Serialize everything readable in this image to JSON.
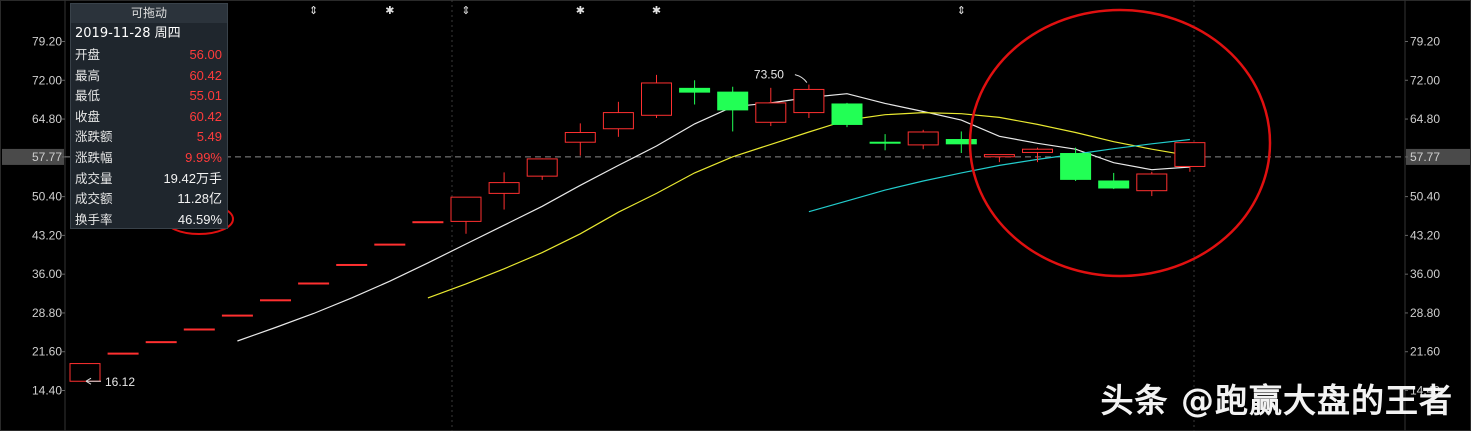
{
  "info_panel": {
    "title": "可拖动",
    "date": "2019-11-28 周四",
    "rows": [
      {
        "label": "开盘",
        "value": "56.00",
        "color": "#ff3b3b"
      },
      {
        "label": "最高",
        "value": "60.42",
        "color": "#ff3b3b"
      },
      {
        "label": "最低",
        "value": "55.01",
        "color": "#ff3b3b"
      },
      {
        "label": "收盘",
        "value": "60.42",
        "color": "#ff3b3b"
      },
      {
        "label": "涨跌额",
        "value": "5.49",
        "color": "#ff3b3b"
      },
      {
        "label": "涨跌幅",
        "value": "9.99%",
        "color": "#ff3b3b"
      },
      {
        "label": "成交量",
        "value": "19.42万手",
        "color": "#f2f2f2"
      },
      {
        "label": "成交额",
        "value": "11.28亿",
        "color": "#f2f2f2"
      },
      {
        "label": "换手率",
        "value": "46.59%",
        "color": "#f2f2f2"
      }
    ]
  },
  "watermark": "头条 @跑赢大盘的王者",
  "colors": {
    "up": "#ff3030",
    "down": "#22ff55",
    "ma_white": "#e8e8e8",
    "ma_yellow": "#e8e830",
    "ma_cyan": "#22cccc",
    "annotation_red": "#e01010"
  },
  "chart_data": {
    "type": "candlestick",
    "y_ticks": [
      "79.20",
      "72.00",
      "64.80",
      "57.77",
      "50.40",
      "43.20",
      "36.00",
      "28.80",
      "21.60",
      "14.40"
    ],
    "ylim": [
      9.0,
      84.0
    ],
    "last_price_label": "57.77",
    "annotations": {
      "high": "73.50",
      "low": "16.12"
    },
    "event_markers": [
      "⇕",
      "✱",
      "⇕",
      "✱",
      "✱",
      "⇕"
    ],
    "candles": [
      {
        "o": 16.12,
        "h": 19.4,
        "l": 16.12,
        "c": 19.4
      },
      {
        "o": 21.34,
        "h": 21.34,
        "l": 21.34,
        "c": 21.34
      },
      {
        "o": 23.47,
        "h": 23.47,
        "l": 23.47,
        "c": 23.47
      },
      {
        "o": 25.82,
        "h": 25.82,
        "l": 25.82,
        "c": 25.82
      },
      {
        "o": 28.4,
        "h": 28.4,
        "l": 28.4,
        "c": 28.4
      },
      {
        "o": 31.24,
        "h": 31.24,
        "l": 31.24,
        "c": 31.24
      },
      {
        "o": 34.36,
        "h": 34.36,
        "l": 34.36,
        "c": 34.36
      },
      {
        "o": 37.8,
        "h": 37.8,
        "l": 37.8,
        "c": 37.8
      },
      {
        "o": 41.58,
        "h": 41.58,
        "l": 41.58,
        "c": 41.58
      },
      {
        "o": 45.74,
        "h": 45.74,
        "l": 45.74,
        "c": 45.74
      },
      {
        "o": 45.8,
        "h": 50.3,
        "l": 43.5,
        "c": 50.3
      },
      {
        "o": 51.0,
        "h": 54.9,
        "l": 48.0,
        "c": 53.0
      },
      {
        "o": 54.2,
        "h": 57.5,
        "l": 53.5,
        "c": 57.4
      },
      {
        "o": 60.5,
        "h": 64.0,
        "l": 58.0,
        "c": 62.3
      },
      {
        "o": 63.0,
        "h": 68.0,
        "l": 61.5,
        "c": 66.0
      },
      {
        "o": 65.5,
        "h": 73.0,
        "l": 65.0,
        "c": 71.5
      },
      {
        "o": 70.5,
        "h": 72.0,
        "l": 67.5,
        "c": 69.8
      },
      {
        "o": 69.8,
        "h": 70.8,
        "l": 62.5,
        "c": 66.5
      },
      {
        "o": 64.2,
        "h": 70.6,
        "l": 63.5,
        "c": 67.8
      },
      {
        "o": 66.0,
        "h": 71.2,
        "l": 65.0,
        "c": 70.3
      },
      {
        "o": 67.6,
        "h": 67.8,
        "l": 63.3,
        "c": 63.8
      },
      {
        "o": 60.5,
        "h": 62.0,
        "l": 59.0,
        "c": 60.4
      },
      {
        "o": 60.0,
        "h": 62.8,
        "l": 59.2,
        "c": 62.4
      },
      {
        "o": 61.0,
        "h": 62.5,
        "l": 58.5,
        "c": 60.2
      },
      {
        "o": 57.8,
        "h": 58.2,
        "l": 56.8,
        "c": 58.2
      },
      {
        "o": 58.6,
        "h": 59.5,
        "l": 56.8,
        "c": 59.2
      },
      {
        "o": 58.4,
        "h": 59.5,
        "l": 53.3,
        "c": 53.6
      },
      {
        "o": 53.3,
        "h": 54.8,
        "l": 51.8,
        "c": 52.0
      },
      {
        "o": 51.5,
        "h": 55.0,
        "l": 50.5,
        "c": 54.6
      },
      {
        "o": 56.0,
        "h": 60.42,
        "l": 55.01,
        "c": 60.42
      }
    ],
    "ma_white": [
      null,
      null,
      null,
      null,
      23.6,
      26.1,
      28.7,
      31.6,
      34.7,
      38.1,
      41.6,
      45.1,
      48.6,
      52.5,
      56.2,
      59.8,
      63.9,
      67.1,
      67.8,
      68.8,
      69.5,
      67.7,
      66.2,
      64.6,
      61.6,
      60.3,
      59.2,
      56.7,
      55.4,
      55.9
    ],
    "ma_yellow": [
      null,
      null,
      null,
      null,
      null,
      null,
      null,
      null,
      null,
      31.6,
      34.2,
      37.0,
      40.0,
      43.5,
      47.5,
      51.0,
      54.8,
      57.8,
      60.1,
      62.4,
      64.6,
      65.6,
      66.0,
      65.8,
      65.1,
      63.8,
      62.3,
      60.6,
      59.2,
      58.0
    ],
    "ma_cyan": [
      null,
      null,
      null,
      null,
      null,
      null,
      null,
      null,
      null,
      null,
      null,
      null,
      null,
      null,
      null,
      null,
      null,
      null,
      null,
      47.6,
      49.6,
      51.6,
      53.3,
      54.8,
      56.2,
      57.3,
      58.3,
      59.3,
      60.2,
      61.0
    ]
  }
}
